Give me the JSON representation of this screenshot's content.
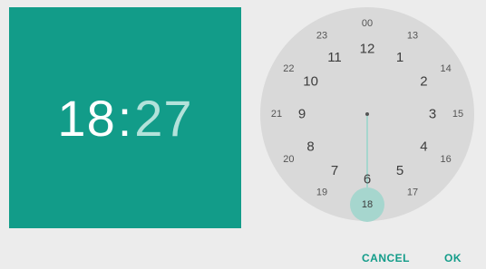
{
  "header": {
    "hour": "18",
    "separator": ":",
    "minute": "27"
  },
  "clock": {
    "selected_hour": "18",
    "outer_ring": [
      "12",
      "1",
      "2",
      "3",
      "4",
      "5",
      "6",
      "7",
      "8",
      "9",
      "10",
      "11"
    ],
    "inner_ring": [
      "00",
      "13",
      "14",
      "15",
      "16",
      "17",
      "18",
      "19",
      "20",
      "21",
      "22",
      "23"
    ]
  },
  "actions": {
    "cancel_label": "CANCEL",
    "ok_label": "OK"
  },
  "colors": {
    "accent": "#129c89",
    "accent_light": "#b2e2da",
    "face": "#d9d9d9",
    "background": "#ececec"
  }
}
